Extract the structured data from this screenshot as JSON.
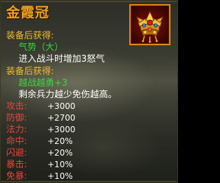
{
  "item": {
    "name": "金霞冠",
    "icon": "golden-crown-icon",
    "name_color": "#f3a01c",
    "icon_border_color": "#e8870f"
  },
  "sections": [
    {
      "title": "装备后获得:",
      "effect_name": "气势（大）",
      "description": "进入战斗时增加3怒气"
    },
    {
      "title": "装备后获得:",
      "effect_name": "越战越勇+3",
      "description": "剩余兵力越少免伤越高。"
    }
  ],
  "stats": [
    {
      "label": "攻击:",
      "value": "+3000"
    },
    {
      "label": "防御:",
      "value": "+2700"
    },
    {
      "label": "法力:",
      "value": "+3000"
    },
    {
      "label": "命中:",
      "value": "+20%"
    },
    {
      "label": "闪避:",
      "value": "+20%"
    },
    {
      "label": "暴击:",
      "value": "+10%"
    },
    {
      "label": "免暴:",
      "value": "+10%"
    }
  ],
  "colors": {
    "section_title": "#f1ba2e",
    "effect_name": "#39d63c",
    "description": "#ffffff",
    "stat_label": "#e84436",
    "stat_value": "#ffffff"
  }
}
